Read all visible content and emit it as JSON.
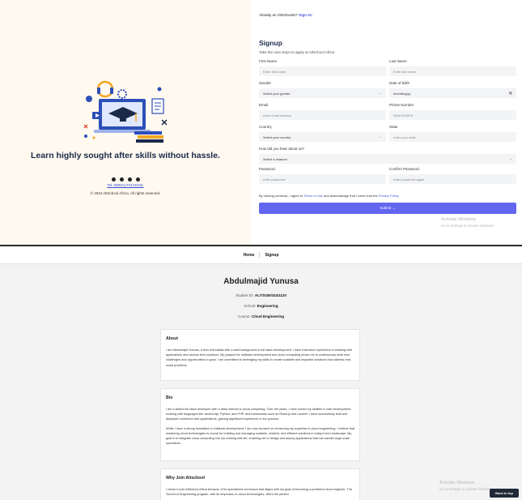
{
  "signup": {
    "tagline": "Learn highly sought after skills without hassle.",
    "telephone": "Tel: 0800ALTSCHOOL",
    "copyright": "© 2024 AltSchool Africa. All rights reserved.",
    "already_prefix": "Already an AltSchooler?",
    "sign_in_label": "Sign In!",
    "title": "Signup",
    "subtitle": "Take the next steps to apply at AltSchool Africa",
    "fields": {
      "first_name": {
        "label": "First Name",
        "placeholder": "Enter first name"
      },
      "last_name": {
        "label": "Last Name",
        "placeholder": "Enter last name"
      },
      "gender": {
        "label": "Gender",
        "value": "Select your gender"
      },
      "dob": {
        "label": "Date of Birth",
        "value": "mm/dd/yyyy"
      },
      "email": {
        "label": "Email",
        "placeholder": "enter email address"
      },
      "phone": {
        "label": "Phone Number",
        "placeholder": "08012345678"
      },
      "country": {
        "label": "Country",
        "value": "Select your country"
      },
      "state": {
        "label": "State",
        "placeholder": "enter your state"
      },
      "heard": {
        "label": "How did you hear about us?",
        "value": "Select a channel"
      },
      "password": {
        "label": "Password",
        "placeholder": "enter password"
      },
      "confirm_password": {
        "label": "Confirm Password",
        "placeholder": "enter password again"
      }
    },
    "terms_prefix": "By clicking continue, I agree to",
    "terms_link": "Terms of Use",
    "terms_middle": "and acknowledge that I have read the",
    "privacy_link": "Privacy Policy",
    "submit_label": "Submit →"
  },
  "watermark": {
    "title": "Activate Windows",
    "subtitle": "Go to Settings to activate Windows."
  },
  "profile": {
    "nav": [
      "Home",
      "Signup"
    ],
    "name": "Abdulmajid Yunusa",
    "student_id_label": "Student ID:",
    "student_id": "ALT/SOE/024/1120",
    "school_label": "School:",
    "school": "Engineering",
    "course_label": "Course:",
    "course": "Cloud Engineering",
    "about_title": "About",
    "about_text": "I am Abdulmajid Yunusa, a tech enthusiast with a solid background in full stack development. I have extensive experience in building web applications and various tech solutions. My passion for software development and cloud computing drives me to continuously seek new challenges and opportunities to grow. I am committed to leveraging my skills to create scalable and impactful solutions that address real-world problems.",
    "bio_title": "Bio",
    "bio_text_1": "I am a skilled full stack developer with a deep interest in cloud computing. Over the years, I have honed my abilities in web development, working with languages like JavaScript, Python, and PHP, and frameworks such as React.js and Laravel. I have successfully built and deployed numerous web applications, gaining significant experience in the process.",
    "bio_text_2": "While I have a strong foundation in fullstack development, I am now focused on enhancing my expertise in cloud engineering. I believe that mastering cloud technologies is crucial for building and managing scalable, resilient, and efficient solutions in today's tech landscape. My goal is to integrate cloud computing into my existing skill set, enabling me to design and deploy applications that can handle large-scale operations.",
    "why_title": "Why Join Altschool",
    "why_text": "I chose to join AltSchool Africa because of its specialized curriculum that aligns with my goal of becoming a proficient cloud engineer. The School of Engineering program, with its emphasis on cloud technologies, offers the perfect",
    "back_to_top": "Back to top"
  }
}
